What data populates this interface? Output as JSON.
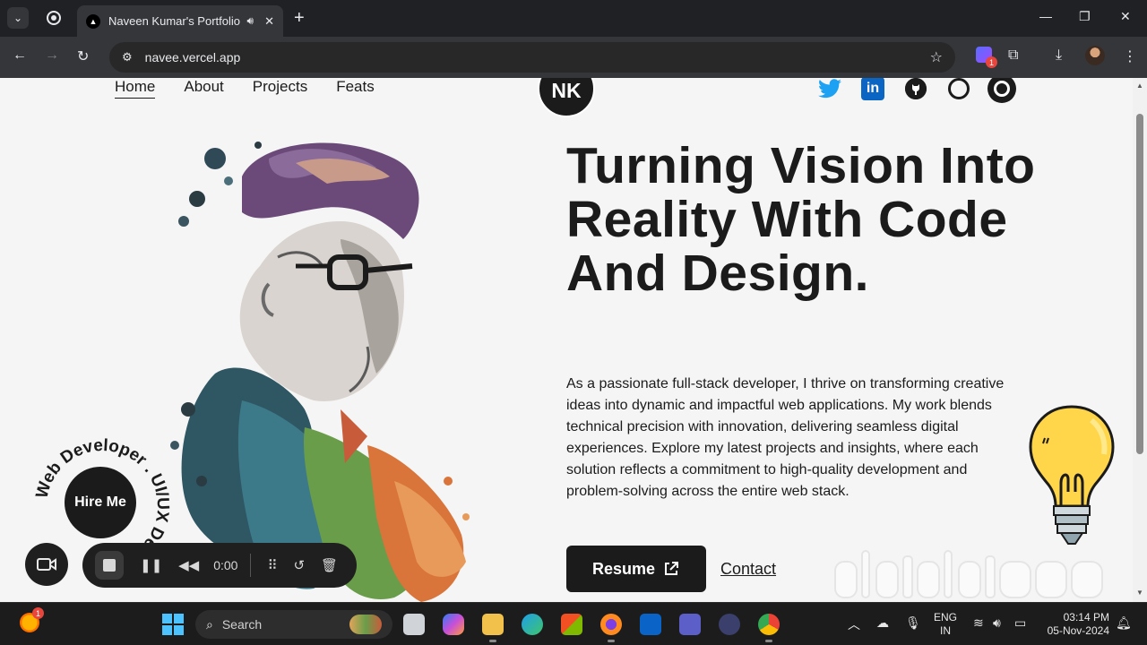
{
  "browser": {
    "tab_title": "Naveen Kumar's Portfolio",
    "tab_favicon_letter": "▲",
    "url": "navee.vercel.app"
  },
  "ext_badge_count": "1",
  "nav": {
    "items": [
      "Home",
      "About",
      "Projects",
      "Feats"
    ],
    "active": "Home"
  },
  "logo": {
    "initials": "NK"
  },
  "socials": [
    "twitter-icon",
    "linkedin-icon",
    "github-icon",
    "whatsapp-icon"
  ],
  "hero": {
    "title": "Turning Vision Into Reality With Code And Design.",
    "description": "As a passionate full-stack developer, I thrive on transforming creative ideas into dynamic and impactful web applications. My work blends technical precision with innovation, delivering seamless digital experiences. Explore my latest projects and insights, where each solution reflects a commitment to high-quality development and problem-solving across the entire web stack.",
    "resume_label": "Resume",
    "contact_label": "Contact"
  },
  "hire_me": {
    "label": "Hire Me",
    "ring_text": "Web Developer . UI/UX Designer . "
  },
  "recorder": {
    "time": "0:00"
  },
  "taskbar": {
    "search_label": "Search",
    "weather_badge": "1",
    "lang_top": "ENG",
    "lang_bottom": "IN",
    "time": "03:14 PM",
    "date": "05-Nov-2024"
  },
  "colors": {
    "page_bg": "#f5f5f5",
    "text": "#1b1b1b",
    "twitter": "#1da1f2",
    "linkedin": "#0a66c2",
    "chrome_dark": "#202124"
  }
}
